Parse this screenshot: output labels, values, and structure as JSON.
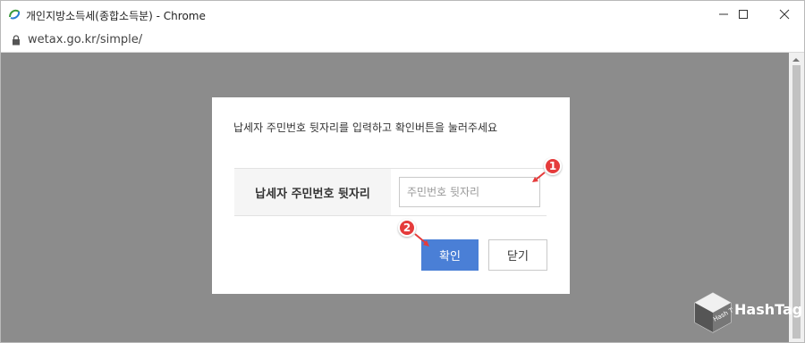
{
  "window": {
    "title": "개인지방소득세(종합소득분) - Chrome",
    "url": "wetax.go.kr/simple/"
  },
  "modal": {
    "message": "납세자 주민번호 뒷자리를 입력하고 확인버튼을 눌러주세요",
    "field_label": "납세자 주민번호 뒷자리",
    "input_placeholder": "주민번호 뒷자리",
    "input_value": "",
    "confirm_label": "확인",
    "close_label": "닫기"
  },
  "annotations": {
    "marker1": "1",
    "marker2": "2"
  },
  "watermark": {
    "logo_text": "Hash Tag",
    "text": "HashTag"
  },
  "colors": {
    "overlay": "#8c8c8c",
    "confirm_button": "#4a7fd6",
    "marker": "#e53b3b"
  },
  "icons": {
    "title": "edge-ie-icon",
    "lock": "lock-icon",
    "minimize": "minimize-icon",
    "maximize": "maximize-icon",
    "close": "close-icon"
  }
}
